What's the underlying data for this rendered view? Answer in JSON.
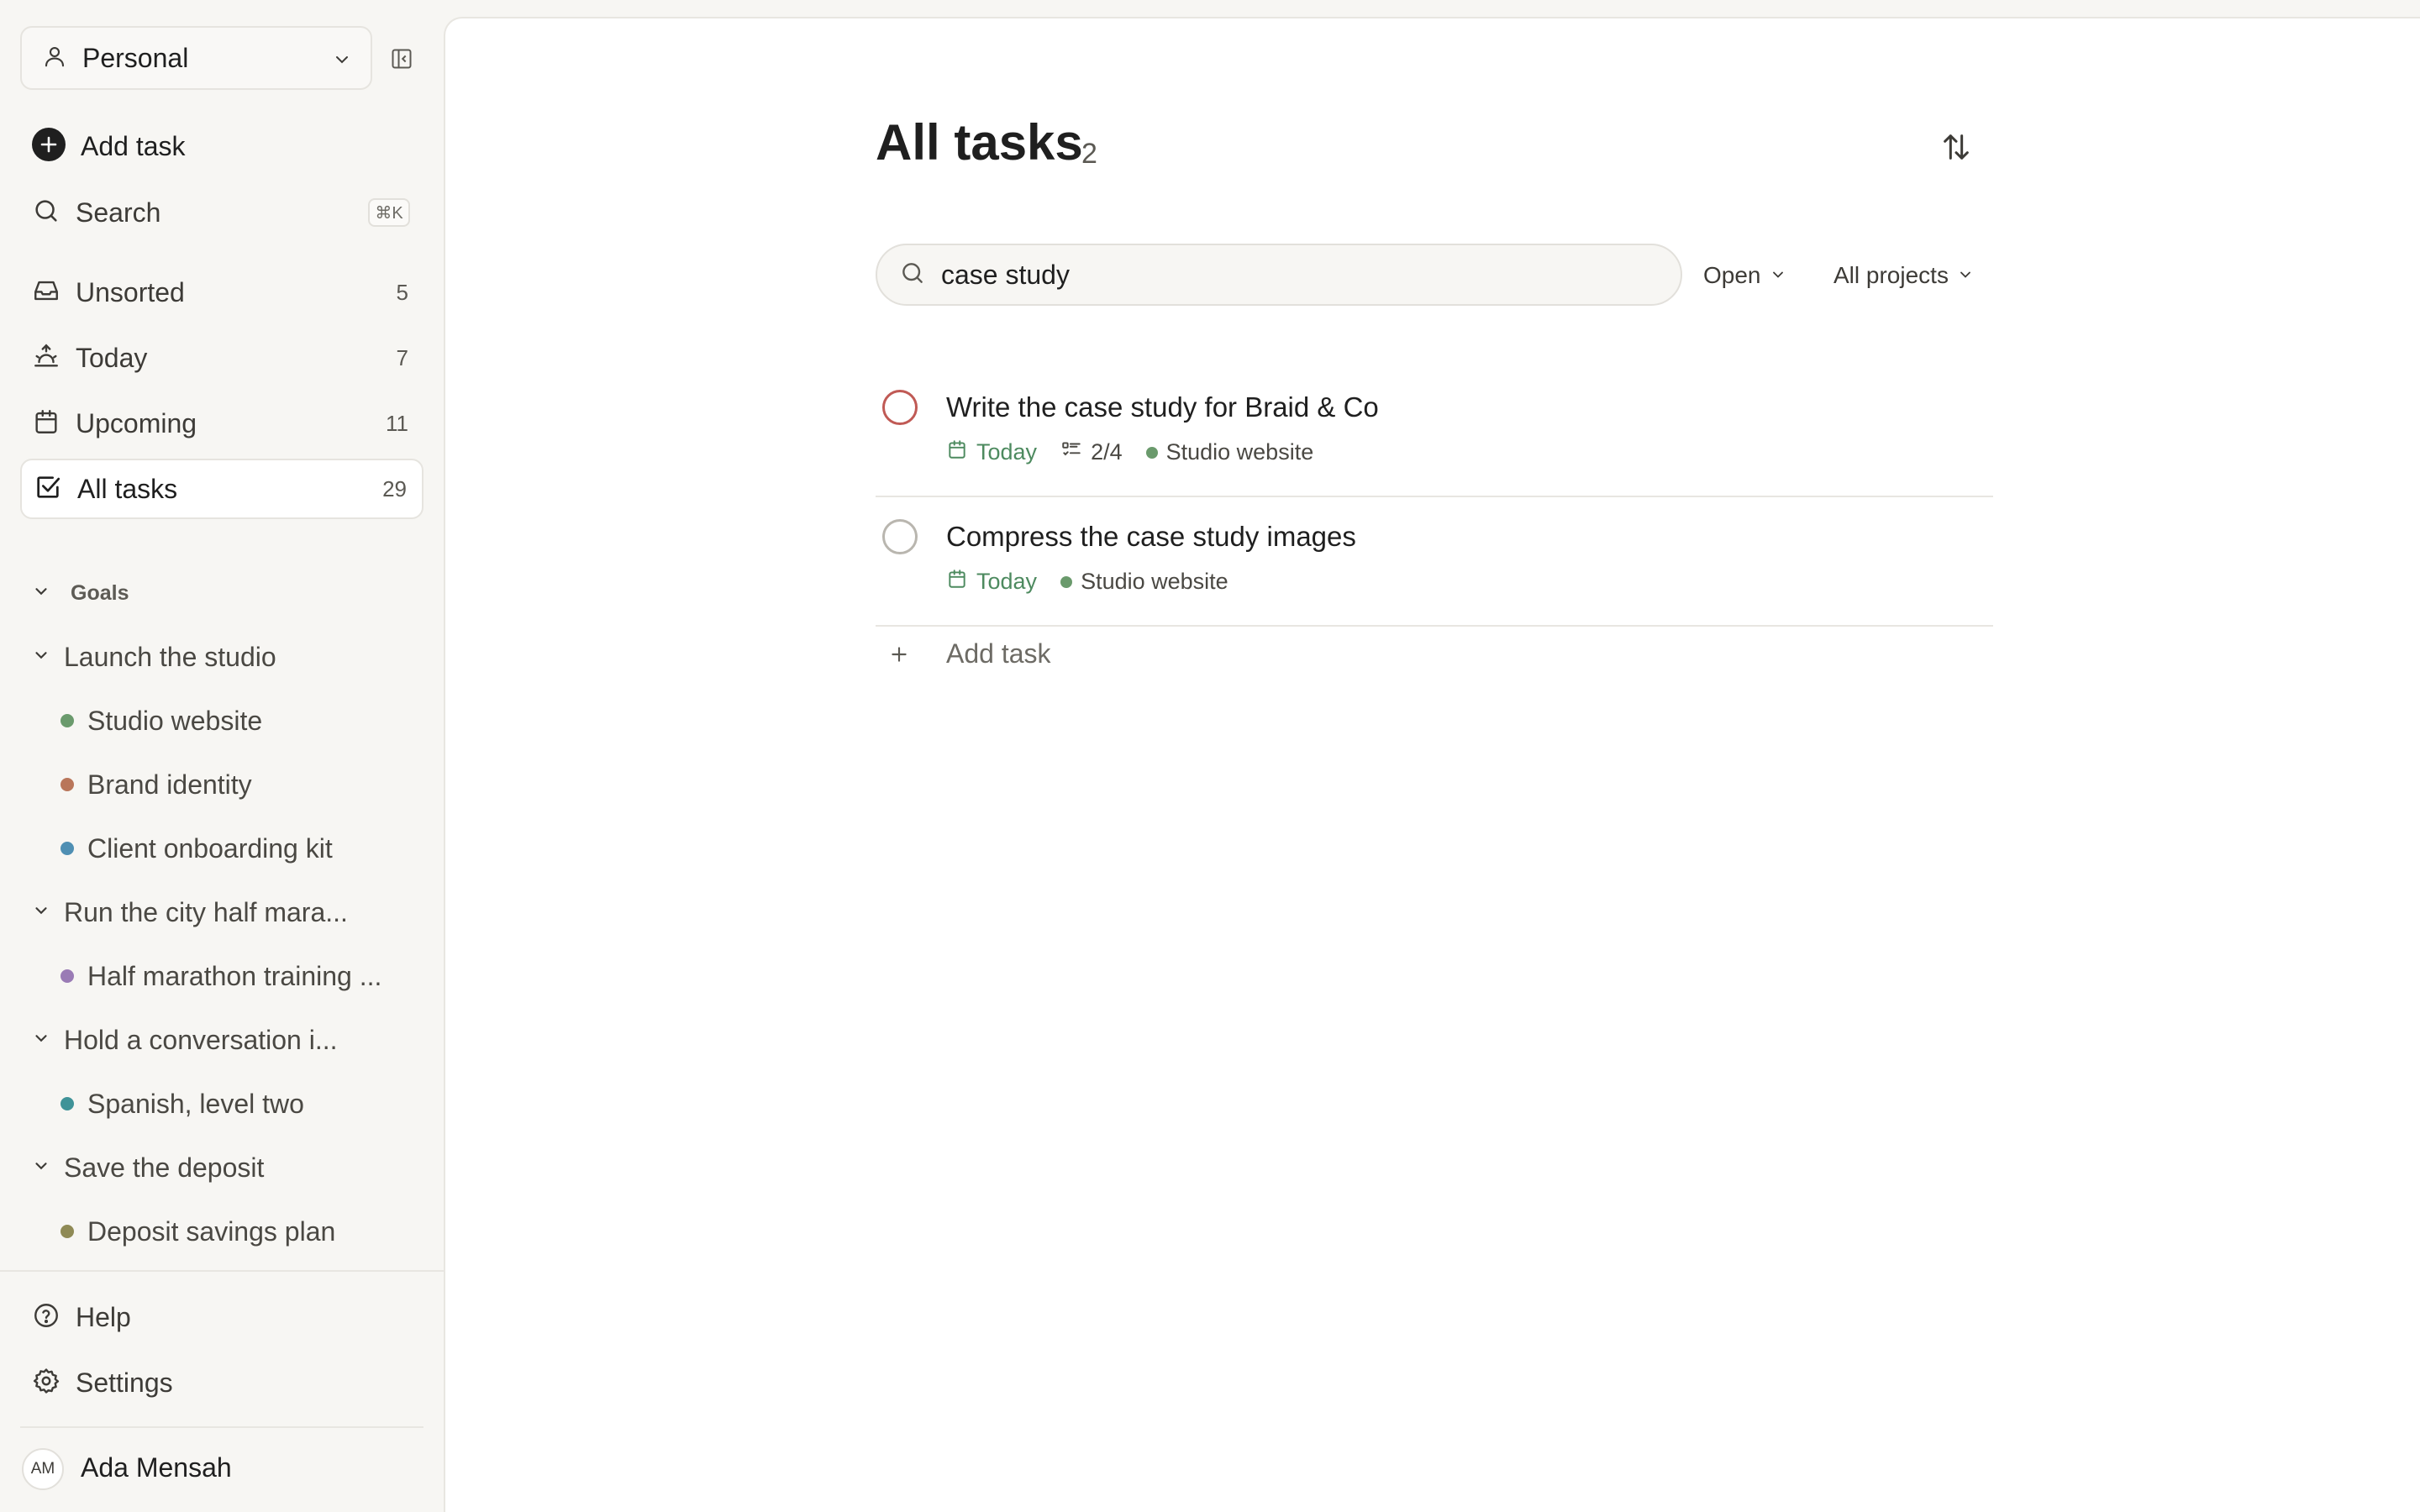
{
  "sidebar": {
    "workspace": {
      "label": "Personal"
    },
    "add_task": "Add task",
    "search": {
      "label": "Search",
      "shortcut": "⌘K"
    },
    "nav": [
      {
        "label": "Unsorted",
        "count": "5"
      },
      {
        "label": "Today",
        "count": "7"
      },
      {
        "label": "Upcoming",
        "count": "11"
      },
      {
        "label": "All tasks",
        "count": "29"
      }
    ],
    "goals_header": "Goals",
    "goals": [
      {
        "label": "Launch the studio"
      },
      {
        "label": "Run the city half mara..."
      },
      {
        "label": "Hold a conversation i..."
      },
      {
        "label": "Save the deposit"
      }
    ],
    "projects": [
      {
        "label": "Studio website",
        "color": "#6a9a6c"
      },
      {
        "label": "Brand identity",
        "color": "#b9765a"
      },
      {
        "label": "Client onboarding kit",
        "color": "#4f8fb3"
      },
      {
        "label": "Half marathon training ...",
        "color": "#9a7bb5"
      },
      {
        "label": "Spanish, level two",
        "color": "#3f9398"
      },
      {
        "label": "Deposit savings plan",
        "color": "#8f8a55"
      }
    ],
    "help": "Help",
    "settings": "Settings",
    "user": {
      "initials": "AM",
      "name": "Ada Mensah"
    }
  },
  "main": {
    "title": "All tasks",
    "count": "2",
    "search_value": "case study",
    "filters": {
      "status": "Open",
      "projects": "All projects"
    },
    "tasks": [
      {
        "name": "Write the case study for Braid & Co",
        "date": "Today",
        "subtasks": "2/4",
        "project": "Studio website"
      },
      {
        "name": "Compress the case study images",
        "date": "Today",
        "project": "Studio website"
      }
    ],
    "add_task": "Add task"
  }
}
